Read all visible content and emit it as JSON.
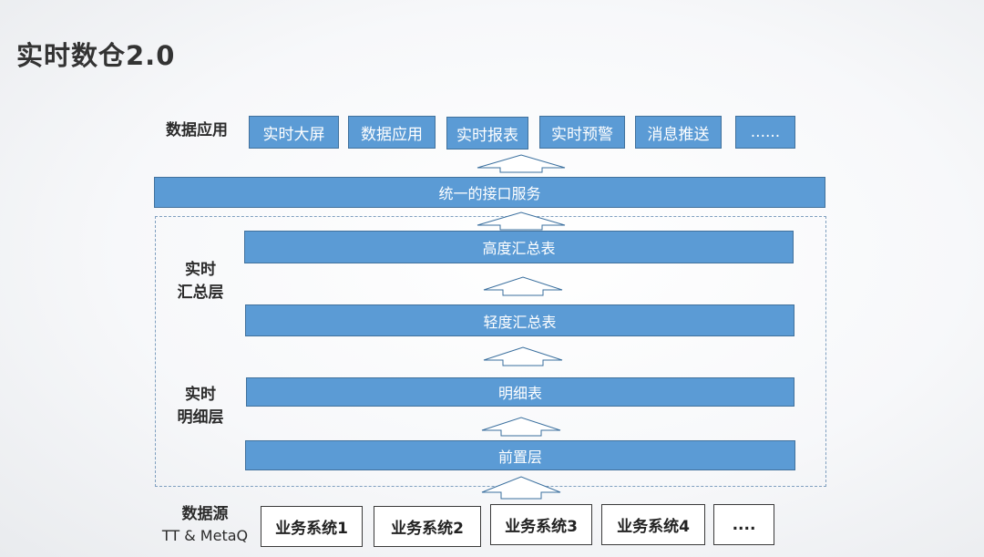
{
  "title": "实时数仓2.0",
  "app_layer": {
    "label": "数据应用",
    "items": [
      "实时大屏",
      "数据应用",
      "实时报表",
      "实时预警",
      "消息推送",
      "......"
    ]
  },
  "service_bar": "统一的接口服务",
  "summary_layer": {
    "label_line1": "实时",
    "label_line2": "汇总层",
    "high": "高度汇总表",
    "light": "轻度汇总表"
  },
  "detail_layer": {
    "label_line1": "实时",
    "label_line2": "明细层",
    "detail": "明细表",
    "front": "前置层"
  },
  "source_layer": {
    "label_line1": "数据源",
    "label_line2": "TT & MetaQ",
    "items": [
      "业务系统1",
      "业务系统2",
      "业务系统3",
      "业务系统4",
      "...."
    ]
  },
  "colors": {
    "box_fill": "#5b9bd5",
    "box_border": "#41719c",
    "dashed_border": "#7f9fbf"
  }
}
